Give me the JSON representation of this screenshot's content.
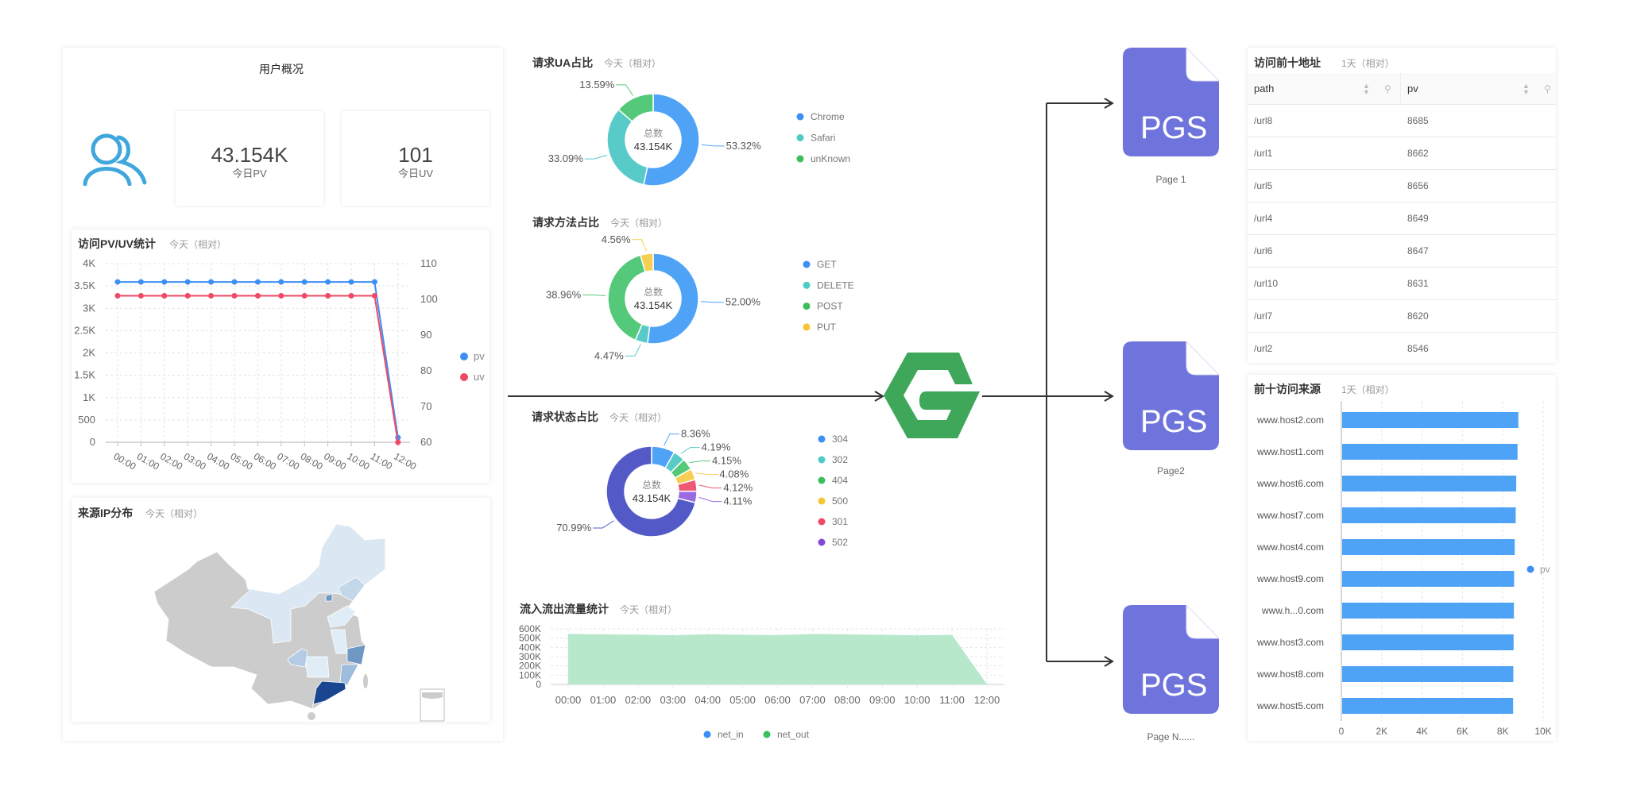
{
  "overview": {
    "title": "用户概况",
    "icon": "users-icon",
    "pv_value": "43.154K",
    "pv_label": "今日PV",
    "uv_value": "101",
    "uv_label": "今日UV"
  },
  "pvuv_chart": {
    "title": "访问PV/UV统计",
    "subtitle": "今天（相对）"
  },
  "ip_map": {
    "title": "来源IP分布",
    "subtitle": "今天（相对）"
  },
  "ua_chart": {
    "title": "请求UA占比",
    "subtitle": "今天（相对）"
  },
  "method_chart": {
    "title": "请求方法占比",
    "subtitle": "今天（相对）"
  },
  "status_chart": {
    "title": "请求状态占比",
    "subtitle": "今天（相对）"
  },
  "traffic_chart": {
    "title": "流入流出流量统计",
    "subtitle": "今天（相对）"
  },
  "top_paths": {
    "title": "访问前十地址",
    "subtitle": "1天（相对）",
    "columns": [
      "path",
      "pv"
    ],
    "rows": [
      [
        "/url8",
        "8685"
      ],
      [
        "/url1",
        "8662"
      ],
      [
        "/url5",
        "8656"
      ],
      [
        "/url4",
        "8649"
      ],
      [
        "/url6",
        "8647"
      ],
      [
        "/url10",
        "8631"
      ],
      [
        "/url7",
        "8620"
      ],
      [
        "/url2",
        "8546"
      ]
    ]
  },
  "top_sources": {
    "title": "前十访问来源",
    "subtitle": "1天（相对）"
  },
  "diagram": {
    "logo": "hexagon-g-logo",
    "pages": [
      {
        "icon": "PGS",
        "label": "Page 1"
      },
      {
        "icon": "PGS",
        "label": "Page2"
      },
      {
        "icon": "PGS",
        "label": "Page N......"
      }
    ]
  },
  "colors": {
    "blue": "#4fa3f7",
    "teal": "#58cbc8",
    "green": "#55c97a",
    "yellow": "#f7cf55",
    "red": "#ee5a74",
    "purple": "#9a6ae0",
    "indigo": "#535ac8",
    "page_icon": "#6e74db",
    "logo_green": "#3fa75a"
  },
  "chart_data": [
    {
      "id": "pvuv",
      "type": "line",
      "categories": [
        "00:00",
        "01:00",
        "02:00",
        "03:00",
        "04:00",
        "05:00",
        "06:00",
        "07:00",
        "08:00",
        "09:00",
        "10:00",
        "11:00",
        "12:00"
      ],
      "y_left": {
        "ticks": [
          "0",
          "500",
          "1K",
          "1.5K",
          "2K",
          "2.5K",
          "3K",
          "3.5K",
          "4K"
        ],
        "range": [
          0,
          4000
        ]
      },
      "y_right": {
        "ticks": [
          "60",
          "70",
          "80",
          "90",
          "100",
          "110"
        ],
        "range": [
          60,
          110
        ]
      },
      "series": [
        {
          "name": "pv",
          "axis": "left",
          "color": "#3d8ff5",
          "values": [
            3590,
            3590,
            3590,
            3590,
            3590,
            3590,
            3590,
            3590,
            3590,
            3590,
            3590,
            3590,
            105
          ]
        },
        {
          "name": "uv",
          "axis": "right",
          "color": "#ee4a66",
          "values": [
            101,
            101,
            101,
            101,
            101,
            101,
            101,
            101,
            101,
            101,
            101,
            101,
            60
          ]
        }
      ],
      "grid": true,
      "legend": "right"
    },
    {
      "id": "ua",
      "type": "pie",
      "center_label": "总数",
      "center_value": "43.154K",
      "slices": [
        {
          "name": "Chrome",
          "value": 53.32,
          "label": "53.32%",
          "color": "#4fa3f7",
          "legend_color": "#3d8ff5"
        },
        {
          "name": "Safari",
          "value": 33.09,
          "label": "33.09%",
          "color": "#58cbc8",
          "legend_color": "#4ecbc4"
        },
        {
          "name": "unKnown",
          "value": 13.59,
          "label": "13.59%",
          "color": "#55c97a",
          "legend_color": "#3dbf5e"
        }
      ],
      "legend": "right"
    },
    {
      "id": "method",
      "type": "pie",
      "center_label": "总数",
      "center_value": "43.154K",
      "slices": [
        {
          "name": "GET",
          "value": 52.0,
          "label": "52.00%",
          "color": "#4fa3f7",
          "legend_color": "#3d8ff5"
        },
        {
          "name": "DELETE",
          "value": 4.47,
          "label": "4.47%",
          "color": "#58cbc8",
          "legend_color": "#4ecbc4"
        },
        {
          "name": "POST",
          "value": 38.96,
          "label": "38.96%",
          "color": "#55c97a",
          "legend_color": "#3dbf5e"
        },
        {
          "name": "PUT",
          "value": 4.56,
          "label": "4.56%",
          "color": "#f7cf55",
          "legend_color": "#f7c531"
        }
      ],
      "legend": "right"
    },
    {
      "id": "status",
      "type": "pie",
      "center_label": "总数",
      "center_value": "43.154K",
      "slices": [
        {
          "name": "304",
          "value": 8.36,
          "label": "8.36%",
          "color": "#4fa3f7",
          "legend_color": "#3d8ff5"
        },
        {
          "name": "302",
          "value": 4.19,
          "label": "4.19%",
          "color": "#58cbc8",
          "legend_color": "#4ecbc4"
        },
        {
          "name": "404",
          "value": 4.15,
          "label": "4.15%",
          "color": "#55c97a",
          "legend_color": "#3dbf5e"
        },
        {
          "name": "500",
          "value": 4.08,
          "label": "4.08%",
          "color": "#f7cf55",
          "legend_color": "#f7c531"
        },
        {
          "name": "301",
          "value": 4.12,
          "label": "4.12%",
          "color": "#ee5a74",
          "legend_color": "#ee4a66"
        },
        {
          "name": "502",
          "value": 4.11,
          "label": "4.11%",
          "color": "#9a6ae0",
          "legend_color": "#8549d6"
        },
        {
          "value": 70.99,
          "label": "70.99%",
          "color": "#535ac8"
        }
      ],
      "legend": "right"
    },
    {
      "id": "traffic",
      "type": "area",
      "categories": [
        "00:00",
        "01:00",
        "02:00",
        "03:00",
        "04:00",
        "05:00",
        "06:00",
        "07:00",
        "08:00",
        "09:00",
        "10:00",
        "11:00",
        "12:00"
      ],
      "y": {
        "ticks": [
          "0",
          "100K",
          "200K",
          "300K",
          "400K",
          "500K",
          "600K"
        ],
        "range": [
          0,
          600000
        ]
      },
      "series": [
        {
          "name": "net_in",
          "color": "#3d8ff5",
          "values": []
        },
        {
          "name": "net_out",
          "color": "#3dbf5e",
          "fill": "#b7e8cc",
          "values": [
            545000,
            540000,
            538000,
            530000,
            542000,
            536000,
            532000,
            545000,
            540000,
            536000,
            530000,
            535000,
            0
          ]
        }
      ],
      "grid": true,
      "legend": "bottom"
    },
    {
      "id": "sources",
      "type": "bar",
      "orientation": "horizontal",
      "categories": [
        "www.host2.com",
        "www.host1.com",
        "www.host6.com",
        "www.host7.com",
        "www.host4.com",
        "www.host9.com",
        "www.h...0.com",
        "www.host3.com",
        "www.host8.com",
        "www.host5.com"
      ],
      "series": [
        {
          "name": "pv",
          "color": "#4fa3f7",
          "legend_color": "#3d8ff5",
          "values": [
            8770,
            8730,
            8665,
            8640,
            8590,
            8560,
            8550,
            8535,
            8520,
            8510
          ]
        }
      ],
      "x": {
        "ticks": [
          "0",
          "2K",
          "4K",
          "6K",
          "8K",
          "10K"
        ],
        "range": [
          0,
          10000
        ]
      },
      "grid": true,
      "legend": "right"
    }
  ]
}
